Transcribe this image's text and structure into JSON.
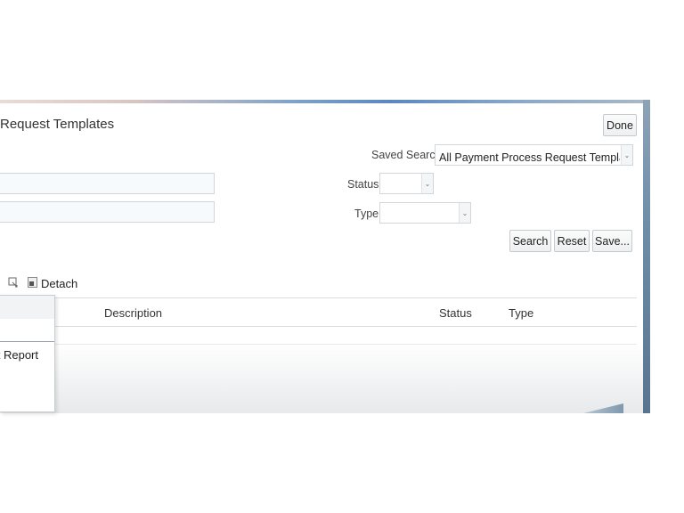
{
  "page": {
    "title": "Request Templates"
  },
  "header": {
    "done_label": "Done"
  },
  "search": {
    "saved_search_label": "Saved Search",
    "saved_search_value": "All Payment Process Request Templates",
    "status_label": "Status",
    "status_value": "",
    "type_label": "Type",
    "type_value": "",
    "name_value": "",
    "field2_value": "",
    "search_label": "Search",
    "reset_label": "Reset",
    "save_label": "Save..."
  },
  "toolbar": {
    "detach_label": "Detach"
  },
  "table": {
    "columns": [
      "Description",
      "Status",
      "Type"
    ]
  },
  "popup_menu": {
    "items": [
      "nt Report"
    ]
  }
}
